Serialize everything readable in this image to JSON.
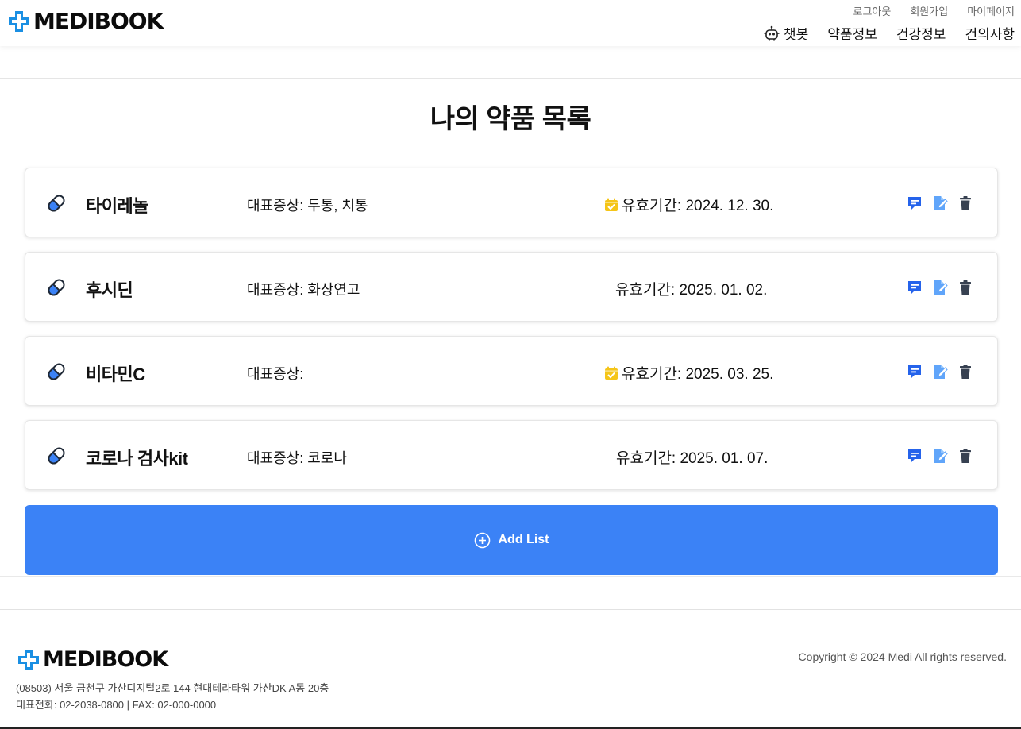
{
  "brand": {
    "name": "MEDIBOOK",
    "color": "#1a8fe3"
  },
  "top_links": [
    "로그아웃",
    "회원가입",
    "마이페이지"
  ],
  "nav": {
    "chatbot": "챗봇",
    "drug_info": "약품정보",
    "health_info": "건강정보",
    "suggestions": "건의사항"
  },
  "page_title": "나의 약품 목록",
  "medicines": [
    {
      "name": "타이레놀",
      "symptom": "대표증상: 두통, 치통",
      "expiry": "유효기간: 2024. 12. 30.",
      "calendar_icon": true
    },
    {
      "name": "후시딘",
      "symptom": "대표증상: 화상연고",
      "expiry": "유효기간: 2025. 01. 02.",
      "calendar_icon": false
    },
    {
      "name": "비타민C",
      "symptom": "대표증상:",
      "expiry": "유효기간: 2025. 03. 25.",
      "calendar_icon": true
    },
    {
      "name": "코로나 검사kit",
      "symptom": "대표증상: 코로나",
      "expiry": "유효기간: 2025. 01. 07.",
      "calendar_icon": false
    }
  ],
  "add_button_label": "Add List",
  "footer": {
    "address": "(08503) 서울 금천구 가산디지털2로 144 현대테라타워 가산DK A동 20층",
    "phone": "대표전화: 02-2038-0800 | FAX: 02-000-0000",
    "copyright": "Copyright © 2024 Medi All rights reserved."
  },
  "colors": {
    "accent": "#3b82f6",
    "calendar": "#f5c518",
    "memo": "#2563eb",
    "edit": "#60a5fa",
    "delete": "#374151"
  },
  "icons": [
    "medibook-cross-logo",
    "robot-icon",
    "pill-icon",
    "calendar-check-icon",
    "memo-icon",
    "edit-icon",
    "trash-icon",
    "plus-circle-icon"
  ]
}
